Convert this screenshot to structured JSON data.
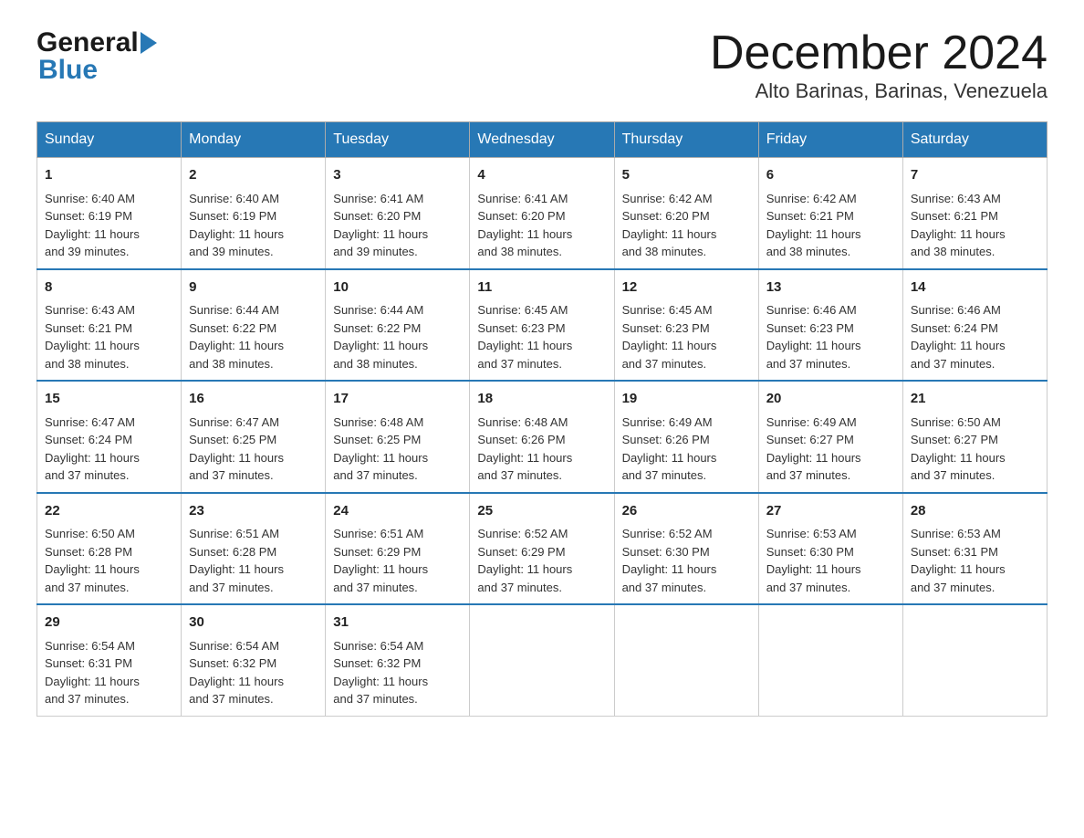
{
  "header": {
    "logo_general": "General",
    "logo_blue": "Blue",
    "title": "December 2024",
    "subtitle": "Alto Barinas, Barinas, Venezuela"
  },
  "weekdays": [
    "Sunday",
    "Monday",
    "Tuesday",
    "Wednesday",
    "Thursday",
    "Friday",
    "Saturday"
  ],
  "weeks": [
    [
      {
        "day": "1",
        "sunrise": "6:40 AM",
        "sunset": "6:19 PM",
        "daylight": "11 hours and 39 minutes."
      },
      {
        "day": "2",
        "sunrise": "6:40 AM",
        "sunset": "6:19 PM",
        "daylight": "11 hours and 39 minutes."
      },
      {
        "day": "3",
        "sunrise": "6:41 AM",
        "sunset": "6:20 PM",
        "daylight": "11 hours and 39 minutes."
      },
      {
        "day": "4",
        "sunrise": "6:41 AM",
        "sunset": "6:20 PM",
        "daylight": "11 hours and 38 minutes."
      },
      {
        "day": "5",
        "sunrise": "6:42 AM",
        "sunset": "6:20 PM",
        "daylight": "11 hours and 38 minutes."
      },
      {
        "day": "6",
        "sunrise": "6:42 AM",
        "sunset": "6:21 PM",
        "daylight": "11 hours and 38 minutes."
      },
      {
        "day": "7",
        "sunrise": "6:43 AM",
        "sunset": "6:21 PM",
        "daylight": "11 hours and 38 minutes."
      }
    ],
    [
      {
        "day": "8",
        "sunrise": "6:43 AM",
        "sunset": "6:21 PM",
        "daylight": "11 hours and 38 minutes."
      },
      {
        "day": "9",
        "sunrise": "6:44 AM",
        "sunset": "6:22 PM",
        "daylight": "11 hours and 38 minutes."
      },
      {
        "day": "10",
        "sunrise": "6:44 AM",
        "sunset": "6:22 PM",
        "daylight": "11 hours and 38 minutes."
      },
      {
        "day": "11",
        "sunrise": "6:45 AM",
        "sunset": "6:23 PM",
        "daylight": "11 hours and 37 minutes."
      },
      {
        "day": "12",
        "sunrise": "6:45 AM",
        "sunset": "6:23 PM",
        "daylight": "11 hours and 37 minutes."
      },
      {
        "day": "13",
        "sunrise": "6:46 AM",
        "sunset": "6:23 PM",
        "daylight": "11 hours and 37 minutes."
      },
      {
        "day": "14",
        "sunrise": "6:46 AM",
        "sunset": "6:24 PM",
        "daylight": "11 hours and 37 minutes."
      }
    ],
    [
      {
        "day": "15",
        "sunrise": "6:47 AM",
        "sunset": "6:24 PM",
        "daylight": "11 hours and 37 minutes."
      },
      {
        "day": "16",
        "sunrise": "6:47 AM",
        "sunset": "6:25 PM",
        "daylight": "11 hours and 37 minutes."
      },
      {
        "day": "17",
        "sunrise": "6:48 AM",
        "sunset": "6:25 PM",
        "daylight": "11 hours and 37 minutes."
      },
      {
        "day": "18",
        "sunrise": "6:48 AM",
        "sunset": "6:26 PM",
        "daylight": "11 hours and 37 minutes."
      },
      {
        "day": "19",
        "sunrise": "6:49 AM",
        "sunset": "6:26 PM",
        "daylight": "11 hours and 37 minutes."
      },
      {
        "day": "20",
        "sunrise": "6:49 AM",
        "sunset": "6:27 PM",
        "daylight": "11 hours and 37 minutes."
      },
      {
        "day": "21",
        "sunrise": "6:50 AM",
        "sunset": "6:27 PM",
        "daylight": "11 hours and 37 minutes."
      }
    ],
    [
      {
        "day": "22",
        "sunrise": "6:50 AM",
        "sunset": "6:28 PM",
        "daylight": "11 hours and 37 minutes."
      },
      {
        "day": "23",
        "sunrise": "6:51 AM",
        "sunset": "6:28 PM",
        "daylight": "11 hours and 37 minutes."
      },
      {
        "day": "24",
        "sunrise": "6:51 AM",
        "sunset": "6:29 PM",
        "daylight": "11 hours and 37 minutes."
      },
      {
        "day": "25",
        "sunrise": "6:52 AM",
        "sunset": "6:29 PM",
        "daylight": "11 hours and 37 minutes."
      },
      {
        "day": "26",
        "sunrise": "6:52 AM",
        "sunset": "6:30 PM",
        "daylight": "11 hours and 37 minutes."
      },
      {
        "day": "27",
        "sunrise": "6:53 AM",
        "sunset": "6:30 PM",
        "daylight": "11 hours and 37 minutes."
      },
      {
        "day": "28",
        "sunrise": "6:53 AM",
        "sunset": "6:31 PM",
        "daylight": "11 hours and 37 minutes."
      }
    ],
    [
      {
        "day": "29",
        "sunrise": "6:54 AM",
        "sunset": "6:31 PM",
        "daylight": "11 hours and 37 minutes."
      },
      {
        "day": "30",
        "sunrise": "6:54 AM",
        "sunset": "6:32 PM",
        "daylight": "11 hours and 37 minutes."
      },
      {
        "day": "31",
        "sunrise": "6:54 AM",
        "sunset": "6:32 PM",
        "daylight": "11 hours and 37 minutes."
      },
      null,
      null,
      null,
      null
    ]
  ],
  "labels": {
    "sunrise": "Sunrise:",
    "sunset": "Sunset:",
    "daylight": "Daylight:"
  }
}
